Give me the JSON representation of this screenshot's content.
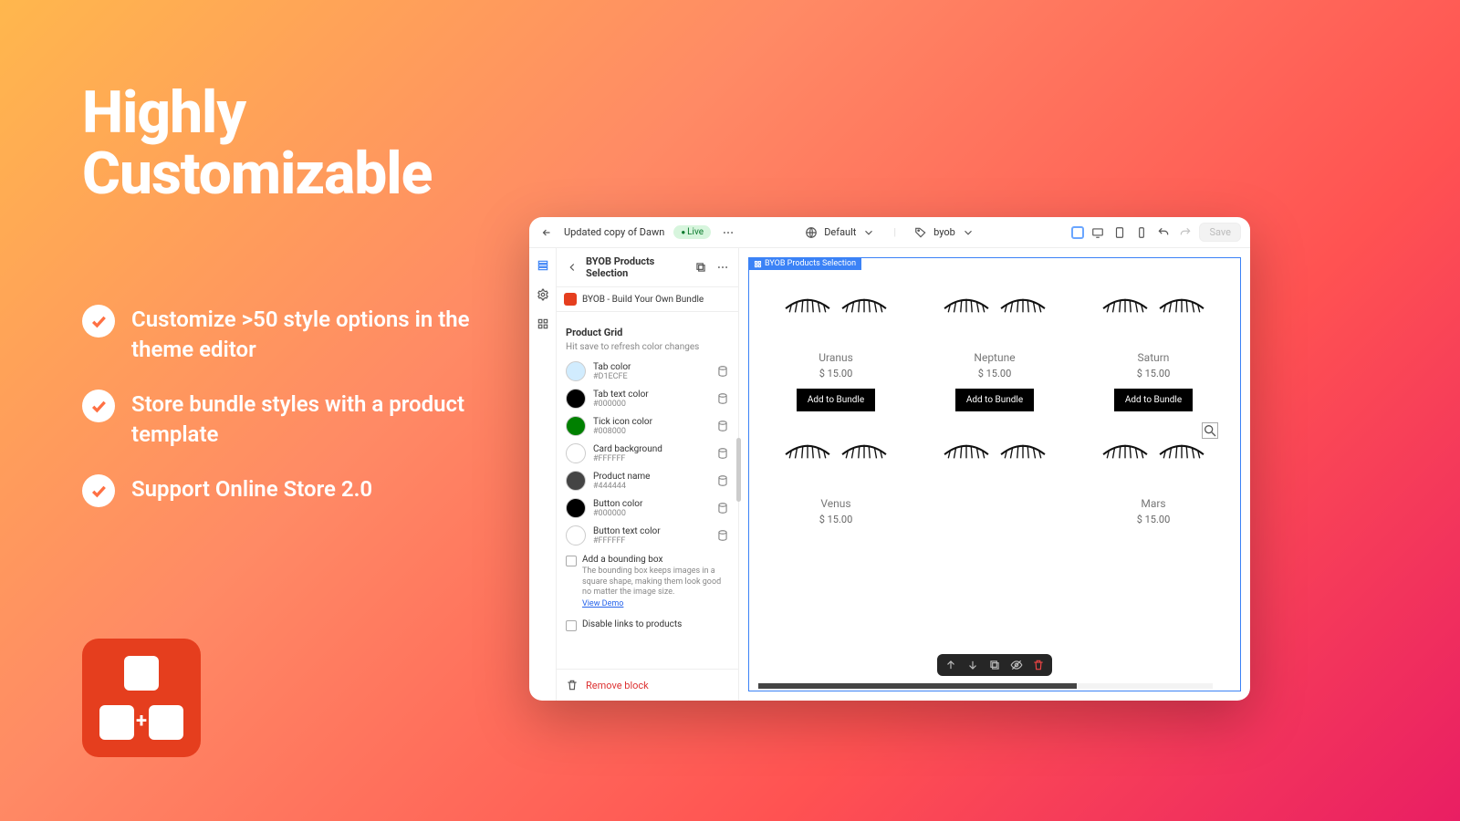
{
  "hero": {
    "title": "Highly Customizable"
  },
  "features": [
    "Customize >50 style options in the theme editor",
    "Store bundle styles with a product template",
    "Support Online Store 2.0"
  ],
  "topbar": {
    "theme_name": "Updated copy of Dawn",
    "live_label": "Live",
    "zone_label": "Default",
    "template_label": "byob",
    "save_label": "Save"
  },
  "sidepanel": {
    "section_title": "BYOB Products Selection",
    "app_name": "BYOB - Build Your Own Bundle",
    "grid_heading": "Product Grid",
    "grid_hint": "Hit save to refresh color changes",
    "colors": [
      {
        "label": "Tab color",
        "value": "#D1ECFE",
        "swatch": "#D1ECFE"
      },
      {
        "label": "Tab text color",
        "value": "#000000",
        "swatch": "#000000"
      },
      {
        "label": "Tick icon color",
        "value": "#008000",
        "swatch": "#008000"
      },
      {
        "label": "Card background",
        "value": "#FFFFFF",
        "swatch": "#FFFFFF"
      },
      {
        "label": "Product name",
        "value": "#444444",
        "swatch": "#444444"
      },
      {
        "label": "Button color",
        "value": "#000000",
        "swatch": "#000000"
      },
      {
        "label": "Button text color",
        "value": "#FFFFFF",
        "swatch": "#FFFFFF"
      }
    ],
    "bounding": {
      "label": "Add a bounding box",
      "desc": "The bounding box keeps images in a square shape, making them look good no matter the image size.",
      "link": "View Demo"
    },
    "disable_links_label": "Disable links to products",
    "remove_label": "Remove block"
  },
  "preview": {
    "selection_label": "BYOB Products Selection",
    "add_label": "Add to Bundle",
    "row1": [
      {
        "name": "Uranus",
        "price": "$ 15.00"
      },
      {
        "name": "Neptune",
        "price": "$ 15.00"
      },
      {
        "name": "Saturn",
        "price": "$ 15.00"
      }
    ],
    "row2": [
      {
        "name": "Venus",
        "price": "$ 15.00"
      },
      {
        "name": "",
        "price": ""
      },
      {
        "name": "Mars",
        "price": "$ 15.00"
      }
    ]
  }
}
